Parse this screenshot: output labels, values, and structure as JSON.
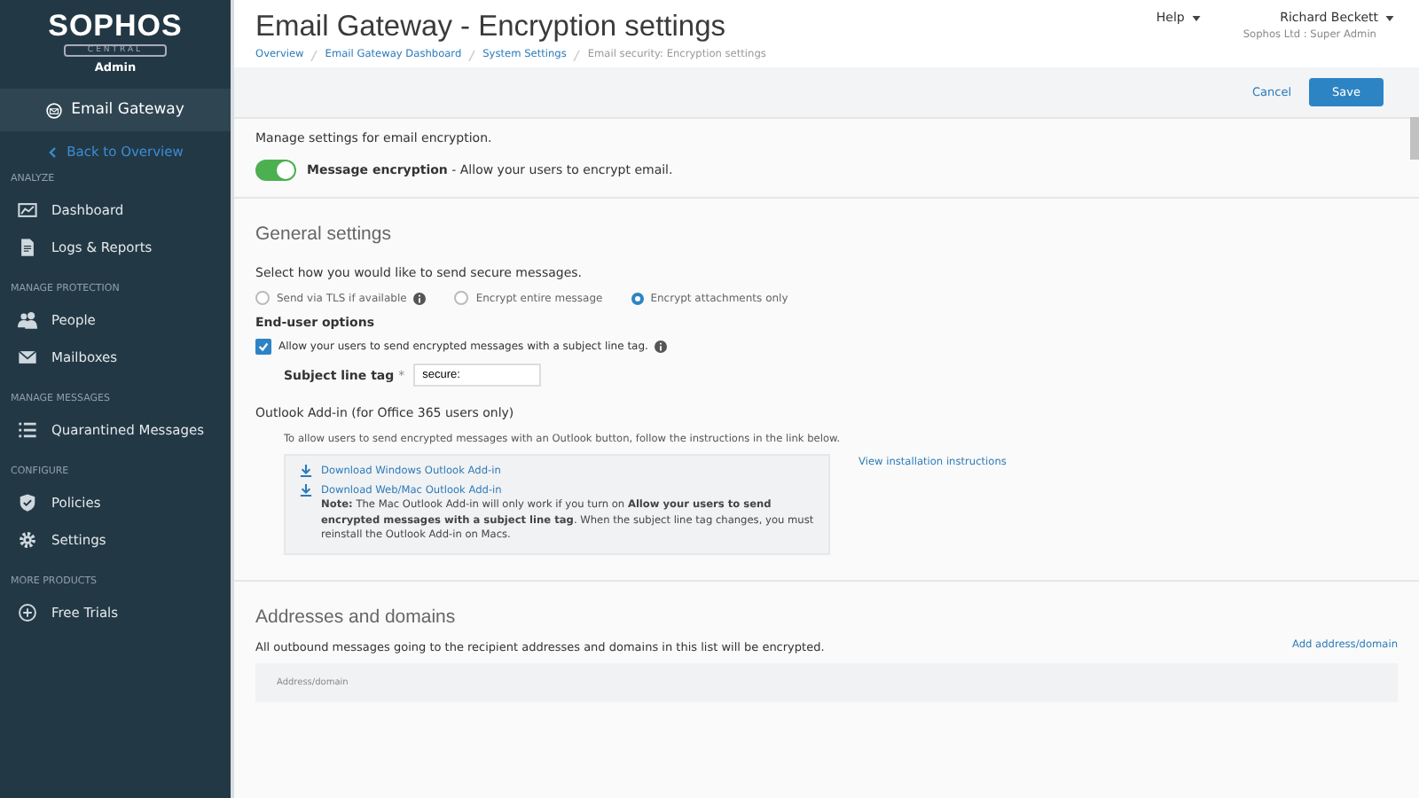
{
  "sidebar": {
    "logo": "SOPHOS",
    "logo_sub": "CENTRAL",
    "role": "Admin",
    "product": "Email Gateway",
    "back": "Back to Overview",
    "sections": [
      {
        "title": "ANALYZE",
        "items": [
          {
            "label": "Dashboard"
          },
          {
            "label": "Logs & Reports"
          }
        ]
      },
      {
        "title": "MANAGE PROTECTION",
        "items": [
          {
            "label": "People"
          },
          {
            "label": "Mailboxes"
          }
        ]
      },
      {
        "title": "MANAGE MESSAGES",
        "items": [
          {
            "label": "Quarantined Messages"
          }
        ]
      },
      {
        "title": "CONFIGURE",
        "items": [
          {
            "label": "Policies"
          },
          {
            "label": "Settings"
          }
        ]
      },
      {
        "title": "MORE PRODUCTS",
        "items": [
          {
            "label": "Free Trials"
          }
        ]
      }
    ]
  },
  "header": {
    "title": "Email Gateway - Encryption settings",
    "breadcrumbs": [
      {
        "label": "Overview",
        "link": true
      },
      {
        "label": "Email Gateway Dashboard",
        "link": true
      },
      {
        "label": "System Settings",
        "link": true
      },
      {
        "label": "Email security: Encryption settings",
        "link": false
      }
    ],
    "help": "Help",
    "user": "Richard Beckett",
    "account": "Sophos Ltd : Super Admin"
  },
  "toolbar": {
    "cancel": "Cancel",
    "save": "Save"
  },
  "intro": "Manage settings for email encryption.",
  "encryption_toggle": {
    "on": true,
    "label": "**Message encryption** - Allow your users to encrypt email."
  },
  "general": {
    "heading": "General settings",
    "prompt": "Select how you would like to send secure messages.",
    "options": [
      {
        "label": "Send via TLS if available",
        "info": true,
        "selected": false
      },
      {
        "label": "Encrypt entire message",
        "info": false,
        "selected": false
      },
      {
        "label": "Encrypt attachments only",
        "info": false,
        "selected": true
      }
    ],
    "end_user_heading": "End-user options",
    "subject_option": {
      "label": "Allow your users to send encrypted messages with a subject line tag.",
      "checked": true
    },
    "subject_tag": {
      "label": "Subject line tag",
      "required": "*",
      "value": "secure:"
    },
    "outlook_heading": "Outlook Add-in (for Office 365 users only)",
    "outlook_text": "To allow users to send encrypted messages with an Outlook button, follow the instructions in the link below.",
    "downloads": [
      "Download Windows Outlook Add-in",
      "Download Web/Mac Outlook Add-in"
    ],
    "note": "**Note:** The Mac Outlook Add-in will only work if you turn on **Allow your users to send encrypted messages with a subject line tag**. When the subject line tag changes, you must reinstall the Outlook Add-in on Macs.",
    "instructions_link": "View installation instructions"
  },
  "addresses": {
    "heading": "Addresses and domains",
    "text": "All outbound messages going to the recipient addresses and domains in this list will be encrypted.",
    "add_link": "Add address/domain",
    "column": "Address/domain"
  }
}
